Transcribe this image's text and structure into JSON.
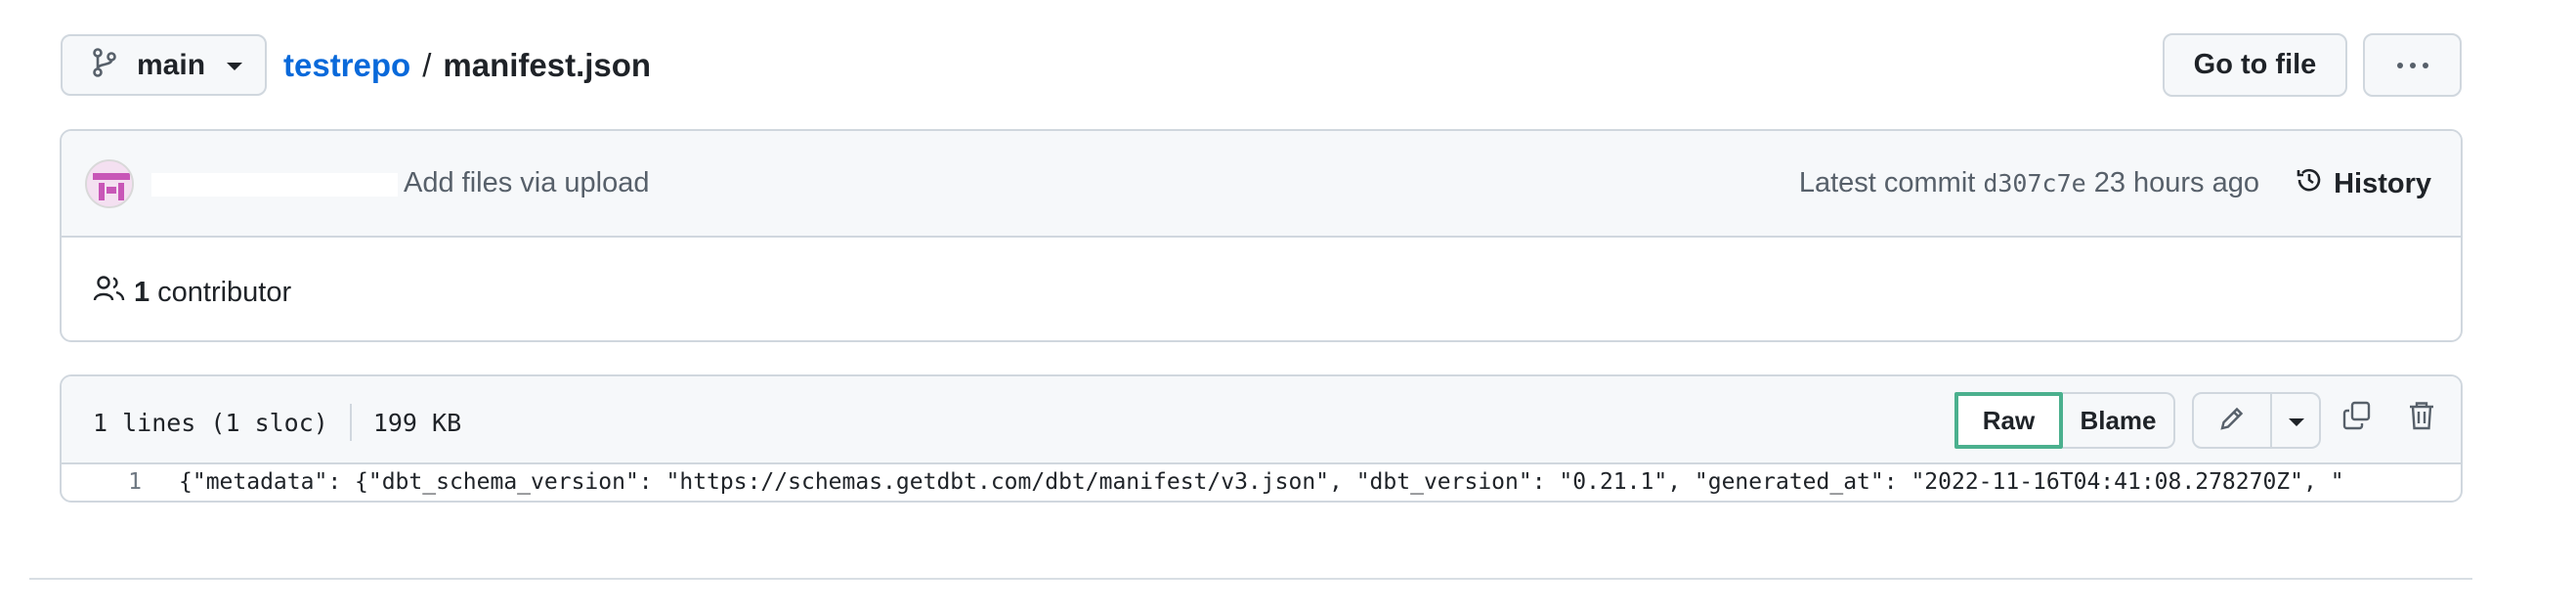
{
  "branch": {
    "name": "main"
  },
  "breadcrumb": {
    "repo": "testrepo",
    "separator": "/",
    "file": "manifest.json"
  },
  "actions": {
    "go_to_file": "Go to file"
  },
  "commit": {
    "message": "Add files via upload",
    "latest_label": "Latest commit",
    "sha": "d307c7e",
    "time": "23 hours ago",
    "history_label": "History"
  },
  "contributors": {
    "count": "1",
    "label": "contributor"
  },
  "file": {
    "lines_info": "1 lines (1 sloc)",
    "size": "199 KB",
    "raw_label": "Raw",
    "blame_label": "Blame",
    "line_number": "1",
    "line_content": "{\"metadata\": {\"dbt_schema_version\": \"https://schemas.getdbt.com/dbt/manifest/v3.json\", \"dbt_version\": \"0.21.1\", \"generated_at\": \"2022-11-16T04:41:08.278270Z\", \""
  },
  "colors": {
    "link": "#0969da",
    "highlight_border": "#4bb08e",
    "border": "#d0d7de",
    "header_bg": "#f6f8fa"
  }
}
